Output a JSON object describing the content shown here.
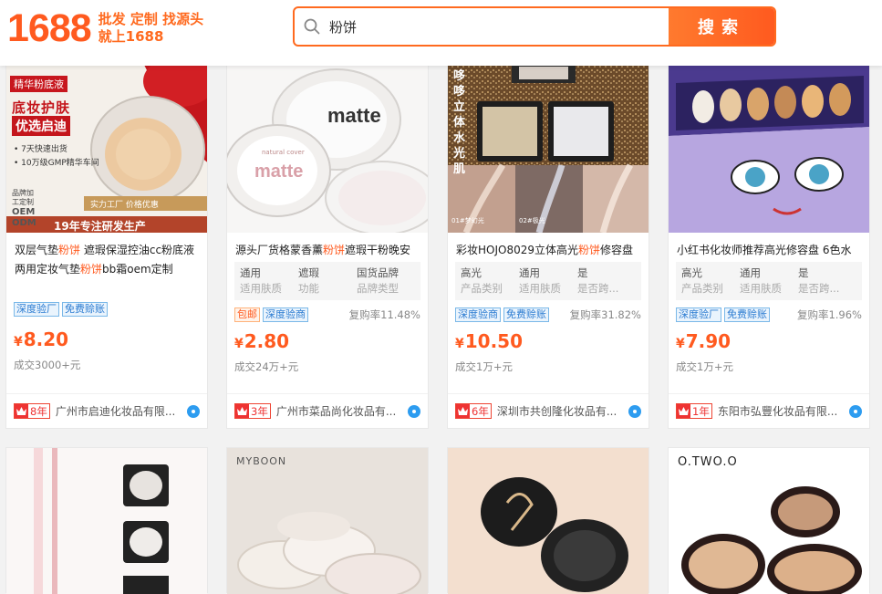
{
  "header": {
    "logo": "1688",
    "slogan_line1": "批发 定制 找源头",
    "slogan_line2": "就上1688",
    "search_value": "粉饼",
    "search_button": "搜索"
  },
  "colors": {
    "accent": "#ff5a1f",
    "tag_blue": "#2b7bd1"
  },
  "products": [
    {
      "title_parts": [
        "双层气垫",
        "粉饼",
        " 遮瑕保湿控油cc粉底液两用定妆气垫",
        "粉饼",
        "bb霜oem定制"
      ],
      "image_text": {
        "badge": "精华粉底液",
        "l1": "底妆护肤",
        "l2": "优选启迪",
        "b1": "• 7天快速出货",
        "b2": "• 10万级GMP精华车间",
        "side": "品牌加工定制",
        "oem": "OEM",
        "odm": "ODM",
        "bar": "实力工厂   价格优惠",
        "footer": "19年专注研发生产"
      },
      "attrs": [],
      "tags": [
        {
          "text": "深度验厂",
          "style": "blue"
        },
        {
          "text": "免费赊账",
          "style": "blue"
        }
      ],
      "repurchase": "",
      "price_symbol": "¥",
      "price": "8.20",
      "sold": "成交3000+元",
      "years": "8年",
      "shop": "广州市启迪化妆品有限..."
    },
    {
      "title_parts": [
        "源头厂货格蒙香薰",
        "粉饼",
        "遮瑕干粉晚安"
      ],
      "image_text": {
        "a": "matte",
        "b": "matte",
        "c": "natural cover"
      },
      "attrs": [
        {
          "value": "通用",
          "key": "适用肤质"
        },
        {
          "value": "遮瑕",
          "key": "功能"
        },
        {
          "value": "国货品牌",
          "key": "品牌类型"
        }
      ],
      "tags": [
        {
          "text": "包邮",
          "style": "orange"
        },
        {
          "text": "深度验商",
          "style": "blue"
        }
      ],
      "repurchase": "复购率11.48%",
      "price_symbol": "¥",
      "price": "2.80",
      "sold": "成交24万+元",
      "years": "3年",
      "shop": "广州市菜品尚化妆品有..."
    },
    {
      "title_parts": [
        "彩妆HOJO8029立体高光",
        "粉饼",
        "修容盘"
      ],
      "image_text": {
        "vertical": "哆哆立体水光肌",
        "c1": "01#梦幻光",
        "c2": "02#极光"
      },
      "attrs": [
        {
          "value": "高光",
          "key": "产品类别"
        },
        {
          "value": "通用",
          "key": "适用肤质"
        },
        {
          "value": "是",
          "key": "是否跨..."
        }
      ],
      "tags": [
        {
          "text": "深度验商",
          "style": "blue"
        },
        {
          "text": "免费赊账",
          "style": "blue"
        }
      ],
      "repurchase": "复购率31.82%",
      "price_symbol": "¥",
      "price": "10.50",
      "sold": "成交1万+元",
      "years": "6年",
      "shop": "深圳市共创隆化妆品有..."
    },
    {
      "title_parts": [
        "小红书化妆师推荐高光修容盘 6色水"
      ],
      "image_text": {},
      "attrs": [
        {
          "value": "高光",
          "key": "产品类别"
        },
        {
          "value": "通用",
          "key": "适用肤质"
        },
        {
          "value": "是",
          "key": "是否跨..."
        }
      ],
      "tags": [
        {
          "text": "深度验厂",
          "style": "blue"
        },
        {
          "text": "免费赊账",
          "style": "blue"
        }
      ],
      "repurchase": "复购率1.96%",
      "price_symbol": "¥",
      "price": "7.90",
      "sold": "成交1万+元",
      "years": "1年",
      "shop": "东阳市弘豐化妆品有限..."
    }
  ],
  "second_row": [
    {
      "image_text": ""
    },
    {
      "image_text": "MYBOON"
    },
    {
      "image_text": ""
    },
    {
      "image_text": "O.TWO.O"
    }
  ]
}
